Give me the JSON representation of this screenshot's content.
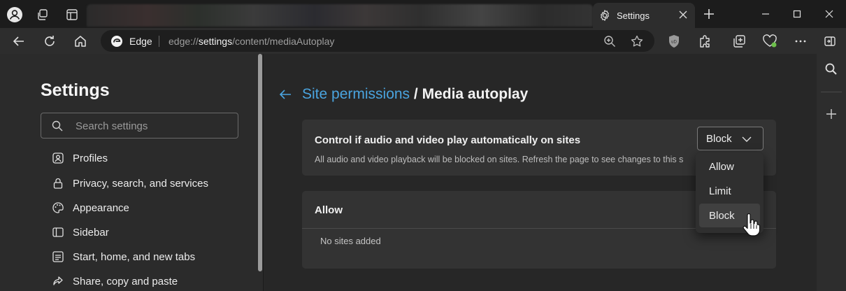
{
  "titlebar": {
    "active_tab_title": "Settings",
    "icons": [
      "profile-icon",
      "workspaces-icon",
      "tab-actions-icon",
      "gear-icon",
      "close-icon",
      "new-tab-icon",
      "minimize-icon",
      "maximize-icon",
      "close-window-icon"
    ]
  },
  "toolbar": {
    "edge_label": "Edge",
    "url_prefix": "edge://",
    "url_host": "settings",
    "url_path": "/content/mediaAutoplay"
  },
  "sidebar": {
    "title": "Settings",
    "search_placeholder": "Search settings",
    "items": [
      {
        "label": "Profiles",
        "icon": "profile-icon"
      },
      {
        "label": "Privacy, search, and services",
        "icon": "lock-icon"
      },
      {
        "label": "Appearance",
        "icon": "palette-icon"
      },
      {
        "label": "Sidebar",
        "icon": "sidebar-icon"
      },
      {
        "label": "Start, home, and new tabs",
        "icon": "home-tabs-icon"
      },
      {
        "label": "Share, copy and paste",
        "icon": "share-icon"
      }
    ]
  },
  "main": {
    "breadcrumb_parent": "Site permissions",
    "breadcrumb_sep": " / ",
    "breadcrumb_current": "Media autoplay",
    "control_card": {
      "title": "Control if audio and video play automatically on sites",
      "description": "All audio and video playback will be blocked on sites. Refresh the page to see changes to this s",
      "selected": "Block"
    },
    "dropdown_options": [
      "Allow",
      "Limit",
      "Block"
    ],
    "allow_card": {
      "title": "Allow",
      "empty_text": "No sites added"
    }
  },
  "colors": {
    "accent": "#4aa4df",
    "background": "#272727",
    "card": "#333333"
  }
}
